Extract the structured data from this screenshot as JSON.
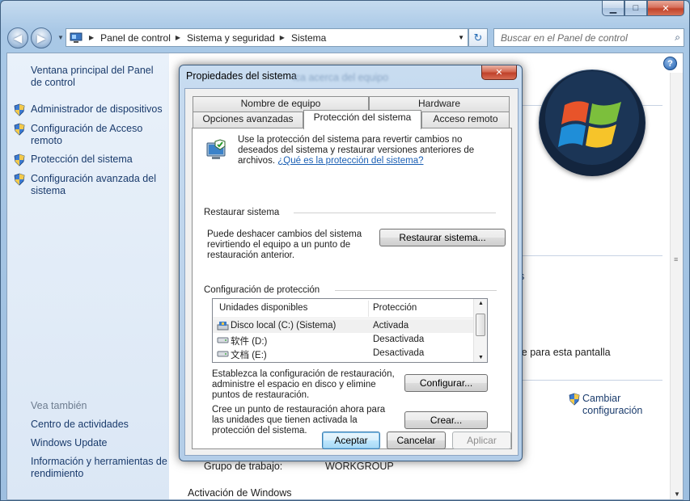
{
  "window": {
    "minimize_icon": "minimize-icon",
    "maximize_icon": "maximize-icon",
    "close_icon": "close-icon"
  },
  "address_bar": {
    "crumbs": [
      "Panel de control",
      "Sistema y seguridad",
      "Sistema"
    ],
    "search_placeholder": "Buscar en el Panel de control"
  },
  "sidebar": {
    "main_link": "Ventana principal del Panel de control",
    "items": [
      {
        "label": "Administrador de dispositivos",
        "icon": "shield-icon"
      },
      {
        "label": "Configuración de Acceso remoto",
        "icon": "shield-icon"
      },
      {
        "label": "Protección del sistema",
        "icon": "shield-icon"
      },
      {
        "label": "Configuración avanzada del sistema",
        "icon": "shield-icon"
      }
    ],
    "see_also_title": "Vea también",
    "see_also": [
      "Centro de actividades",
      "Windows Update",
      "Información y herramientas de rendimiento"
    ]
  },
  "background": {
    "link_fragment": "s",
    "screen_text": "le para esta pantalla",
    "change_config": "Cambiar configuración",
    "workgroup_label": "Grupo de trabajo:",
    "workgroup_value": "WORKGROUP",
    "activation": "Activación de Windows",
    "ghost_title": "ica acerca del equipo"
  },
  "dialog": {
    "title": "Propiedades del sistema",
    "tabs_row1": [
      "Nombre de equipo",
      "Hardware"
    ],
    "tabs_row2": [
      "Opciones avanzadas",
      "Protección del sistema",
      "Acceso remoto"
    ],
    "description": "Use la protección del sistema para revertir cambios no deseados del sistema y restaurar versiones anteriores de archivos.",
    "description_link": "¿Qué es la protección del sistema?",
    "restore_group": "Restaurar sistema",
    "restore_text": "Puede deshacer cambios del sistema revirtiendo el equipo a un punto de restauración anterior.",
    "restore_button": "Restaurar sistema...",
    "protection_group": "Configuración de protección",
    "list_headers": [
      "Unidades disponibles",
      "Protección"
    ],
    "drives": [
      {
        "name": "Disco local (C:) (Sistema)",
        "status": "Activada"
      },
      {
        "name": "软件 (D:)",
        "status": "Desactivada"
      },
      {
        "name": "文档 (E:)",
        "status": "Desactivada"
      }
    ],
    "configure_text": "Establezca la configuración de restauración, administre el espacio en disco y elimine puntos de restauración.",
    "configure_button": "Configurar...",
    "create_text": "Cree un punto de restauración ahora para las unidades que tienen activada la protección del sistema.",
    "create_button": "Crear...",
    "ok_button": "Aceptar",
    "cancel_button": "Cancelar",
    "apply_button": "Aplicar"
  }
}
